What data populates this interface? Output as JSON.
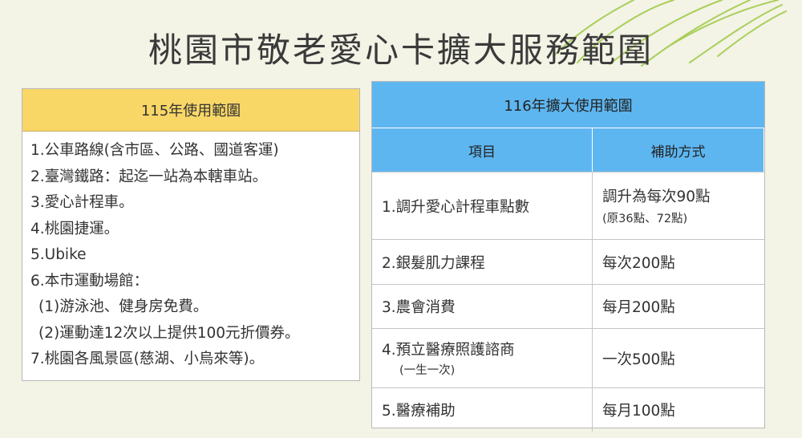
{
  "title": "桃園市敬老愛心卡擴大服務範圍",
  "left": {
    "header": "115年使用範圍",
    "items": [
      "1.公車路線(含市區、公路、國道客運)",
      "2.臺灣鐵路：起迄一站為本轄車站。",
      "3.愛心計程車。",
      "4.桃園捷運。",
      "5.Ubike",
      "6.本市運動場館：",
      "(1)游泳池、健身房免費。",
      "(2)運動達12次以上提供100元折價券。",
      "7.桃園各風景區(慈湖、小烏來等)。"
    ]
  },
  "right": {
    "header": "116年擴大使用範圍",
    "col_item": "項目",
    "col_method": "補助方式",
    "rows": [
      {
        "item": "1.調升愛心計程車點數",
        "item_note": "",
        "method": "調升為每次90點",
        "method_note": "(原36點、72點)"
      },
      {
        "item": "2.銀髮肌力課程",
        "item_note": "",
        "method": "每次200點",
        "method_note": ""
      },
      {
        "item": "3.農會消費",
        "item_note": "",
        "method": "每月200點",
        "method_note": ""
      },
      {
        "item": "4.預立醫療照護諮商",
        "item_note": "(一生一次)",
        "method": "一次500點",
        "method_note": ""
      },
      {
        "item": "5.醫療補助",
        "item_note": "",
        "method": "每月100點",
        "method_note": ""
      }
    ]
  },
  "colors": {
    "background": "#f3f3e6",
    "left_header": "#f9d767",
    "right_header": "#5eb6f0",
    "deco_green": "#a9cf5a"
  }
}
